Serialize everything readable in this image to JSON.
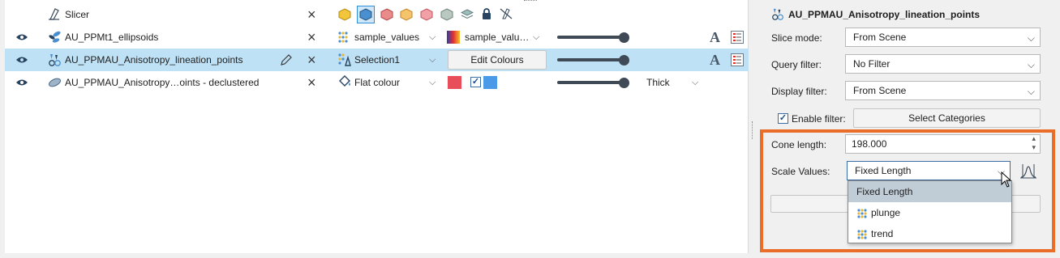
{
  "objects_list": {
    "slicer_label": "Slicer",
    "rows": [
      {
        "name": "AU_PPMt1_ellipsoids",
        "colour_by": "sample_values",
        "colour_map": "sample_valu…",
        "selected": false
      },
      {
        "name": "AU_PPMAU_Anisotropy_lineation_points",
        "colour_by": "Selection1",
        "colour_button": "Edit Colours",
        "selected": true
      },
      {
        "name": "AU_PPMAU_Anisotropy…oints - declustered",
        "colour_by": "Flat colour",
        "line_style": "Thick",
        "selected": false
      }
    ],
    "colours": {
      "flat_red": "#e84d5a",
      "flat_blue": "#4b9ae8",
      "selection_bg": "#bfe1f5"
    }
  },
  "properties": {
    "title": "AU_PPMAU_Anisotropy_lineation_points",
    "slice_mode_label": "Slice mode:",
    "slice_mode_value": "From Scene",
    "query_filter_label": "Query filter:",
    "query_filter_value": "No Filter",
    "display_filter_label": "Display filter:",
    "display_filter_value": "From Scene",
    "enable_filter_label": "Enable filter:",
    "enable_filter_checked": true,
    "select_categories_label": "Select Categories",
    "cone_length_label": "Cone length:",
    "cone_length_value": "198.000",
    "scale_values_label": "Scale Values:",
    "scale_values_value": "Fixed Length",
    "scale_options": [
      "Fixed Length",
      "plunge",
      "trend"
    ],
    "accent_orange": "#ea6d2a"
  }
}
